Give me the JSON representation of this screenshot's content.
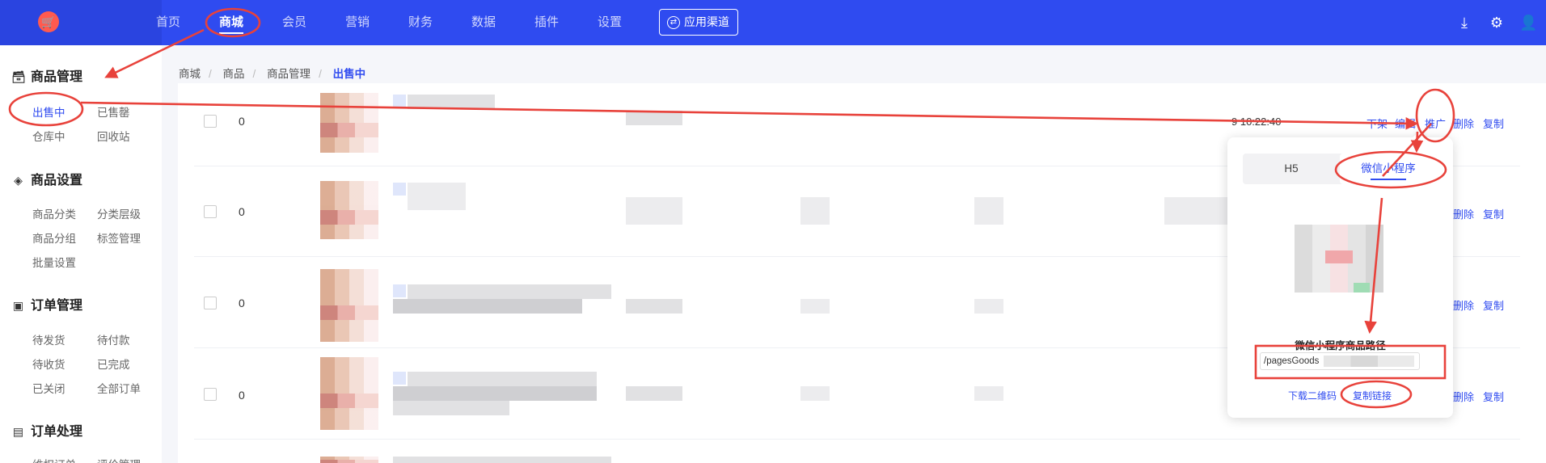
{
  "topnav": {
    "items": [
      "首页",
      "商城",
      "会员",
      "营销",
      "财务",
      "数据",
      "插件",
      "设置"
    ],
    "active": "商城",
    "app_channel": "应用渠道",
    "icons": [
      "download-icon",
      "gear-icon",
      "user-icon"
    ]
  },
  "sidebar": {
    "sections": [
      {
        "title": "商品管理",
        "icon": "archive-icon",
        "links": [
          "出售中",
          "已售罄",
          "仓库中",
          "回收站"
        ]
      },
      {
        "title": "商品设置",
        "icon": "layers-icon",
        "links": [
          "商品分类",
          "分类层级",
          "商品分组",
          "标签管理",
          "批量设置"
        ]
      },
      {
        "title": "订单管理",
        "icon": "kanban-icon",
        "links": [
          "待发货",
          "待付款",
          "待收货",
          "已完成",
          "已关闭",
          "全部订单"
        ]
      },
      {
        "title": "订单处理",
        "icon": "document-icon",
        "links": [
          "维权订单",
          "评价管理"
        ]
      }
    ],
    "active_link": "出售中"
  },
  "breadcrumb": [
    "商城",
    "商品",
    "商品管理",
    "出售中"
  ],
  "rows": [
    {
      "num": "0",
      "time": "9 10:22:40",
      "actions": [
        "下架",
        "编辑",
        "推广",
        "删除",
        "复制"
      ]
    },
    {
      "num": "0",
      "actions": [
        "删除",
        "复制"
      ]
    },
    {
      "num": "0",
      "actions": [
        "删除",
        "复制"
      ]
    },
    {
      "num": "0",
      "actions": [
        "删除",
        "复制"
      ]
    }
  ],
  "popover": {
    "tabs": [
      "H5",
      "微信小程序"
    ],
    "active_tab": "微信小程序",
    "path_title": "微信小程序商品路径",
    "path_value": "/pagesGoods",
    "download_qr": "下载二维码",
    "copy_link": "复制链接"
  },
  "colors": {
    "primary": "#2f4bf0",
    "annotation": "#e8423b"
  }
}
